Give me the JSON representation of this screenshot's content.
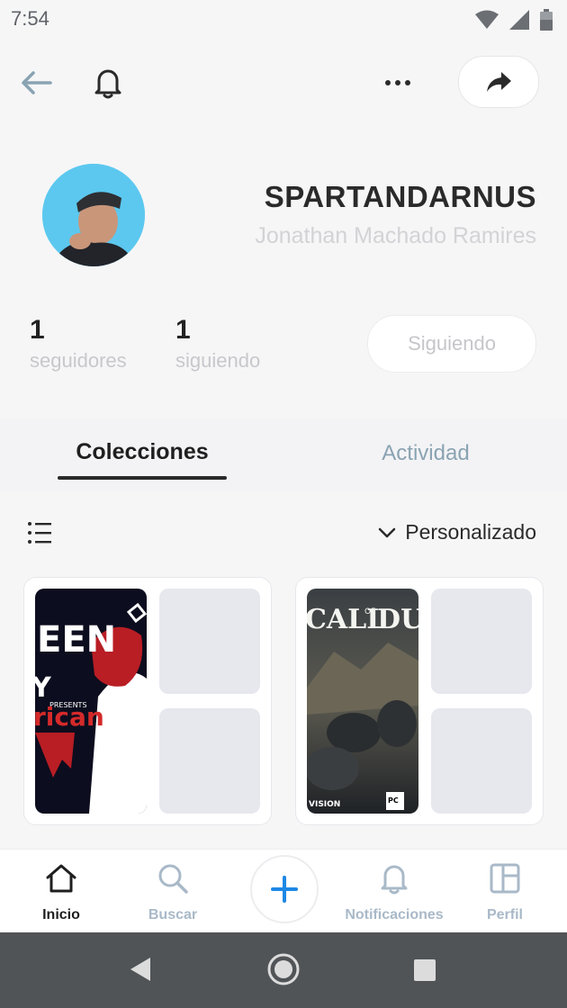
{
  "status_bar": {
    "time": "7:54"
  },
  "header": {
    "icons": [
      "back-arrow-icon",
      "bell-icon",
      "more-dots-icon",
      "share-icon"
    ]
  },
  "profile": {
    "username": "SPARTANDARNUS",
    "full_name": "Jonathan Machado Ramires",
    "followers_count": "1",
    "followers_label": "seguidores",
    "following_count": "1",
    "following_label": "siguiendo",
    "follow_button": "Siguiendo"
  },
  "tabs": [
    {
      "label": "Colecciones",
      "active": true
    },
    {
      "label": "Actividad",
      "active": false
    }
  ],
  "list_controls": {
    "sort_label": "Personalizado"
  },
  "collections": [
    {
      "cover_texts": [
        "EEN",
        "Y",
        "PRESENTS",
        "rican"
      ]
    },
    {
      "cover_texts": [
        "CALL",
        "OF",
        "DUT",
        "VISION",
        "PC"
      ]
    }
  ],
  "bottom_nav": {
    "items": [
      {
        "label": "Inicio",
        "active": true
      },
      {
        "label": "Buscar",
        "active": false
      },
      {
        "label": "Notificaciones",
        "active": false
      },
      {
        "label": "Perfil",
        "active": false
      }
    ]
  },
  "colors": {
    "accent": "#1e88e5",
    "muted": "#a9b9c8",
    "placeholder": "#e6e8ee"
  }
}
